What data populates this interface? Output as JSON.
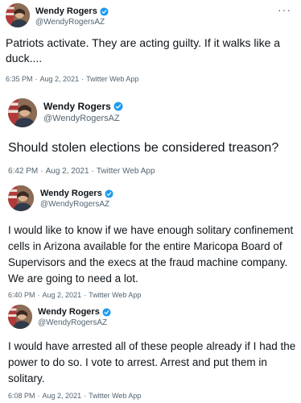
{
  "tweets": [
    {
      "name": "Wendy Rogers",
      "handle": "@WendyRogersAZ",
      "text": "Patriots activate. They are acting guilty. If it walks like a duck....",
      "time": "6:35 PM",
      "date": "Aug 2, 2021",
      "source": "Twitter Web App",
      "more": "···"
    },
    {
      "name": "Wendy Rogers",
      "handle": "@WendyRogersAZ",
      "text": "Should stolen elections be considered treason?",
      "time": "6:42 PM",
      "date": "Aug 2, 2021",
      "source": "Twitter Web App"
    },
    {
      "name": "Wendy Rogers",
      "handle": "@WendyRogersAZ",
      "text": "I would like to know if we have enough solitary confinement cells in Arizona available for the entire Maricopa Board of Supervisors and the execs at the fraud machine company. We are going to need a lot.",
      "time": "6:40 PM",
      "date": "Aug 2, 2021",
      "source": "Twitter Web App"
    },
    {
      "name": "Wendy Rogers",
      "handle": "@WendyRogersAZ",
      "text": "I would have arrested all of these people already if I had the power to do so. I vote to arrest. Arrest and put them in solitary.",
      "time": "6:08 PM",
      "date": "Aug 2, 2021",
      "source": "Twitter Web App"
    }
  ],
  "colors": {
    "verified_blue": "#1d9bf0",
    "secondary_text": "#536471",
    "primary_text": "#0f1419"
  },
  "icons": {
    "verified": "verified-badge-icon",
    "more": "more-options-icon"
  }
}
